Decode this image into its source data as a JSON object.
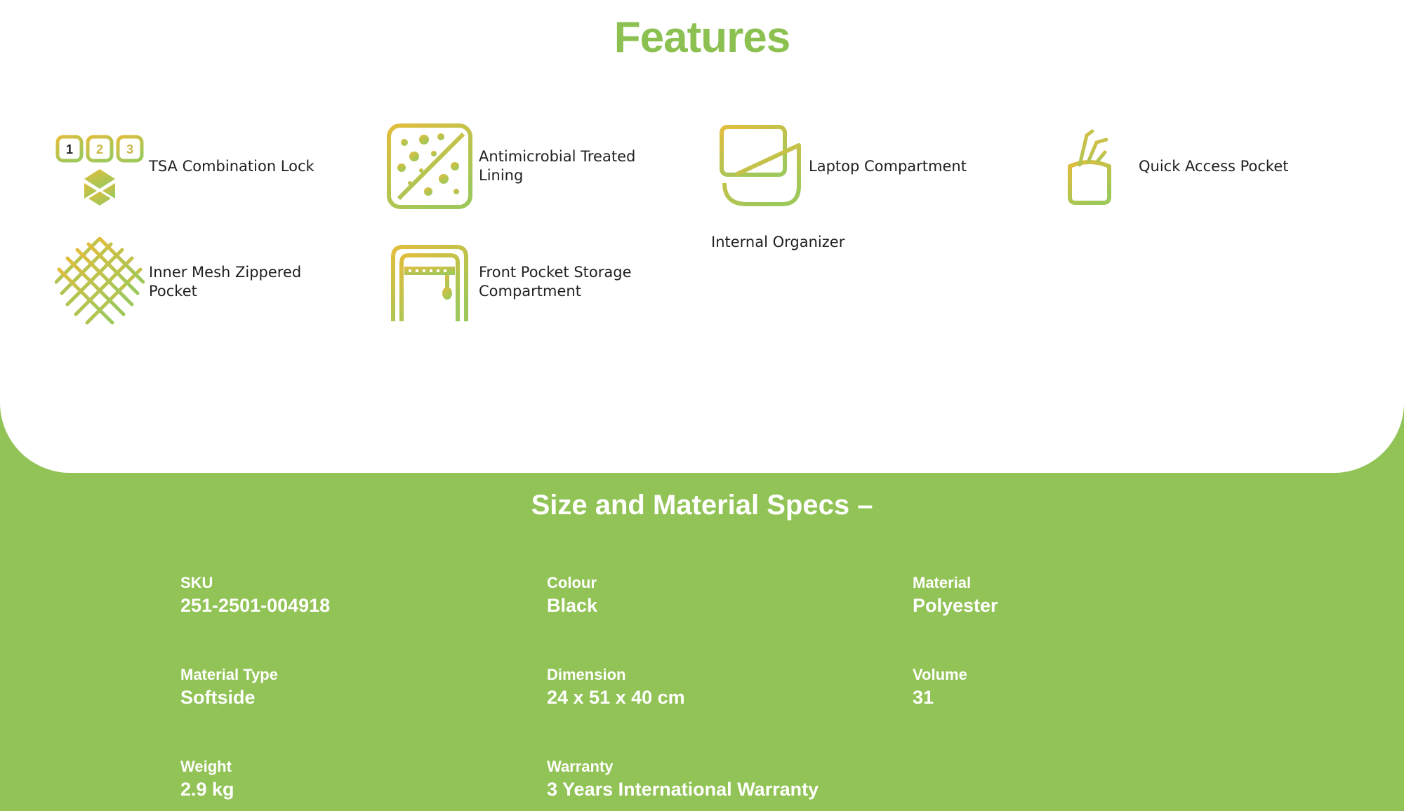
{
  "features": {
    "title": "Features",
    "items": [
      {
        "label": "TSA Combination Lock",
        "icon": "tsa-lock-icon"
      },
      {
        "label": "Antimicrobial Treated Lining",
        "icon": "antimicrobial-icon"
      },
      {
        "label": "Laptop Compartment",
        "icon": "laptop-icon"
      },
      {
        "label": "Quick Access Pocket",
        "icon": "quick-access-pocket-icon"
      },
      {
        "label": "Inner Mesh Zippered Pocket",
        "icon": "mesh-icon"
      },
      {
        "label": "Front Pocket Storage Compartment",
        "icon": "front-pocket-icon"
      }
    ],
    "internal_organizer": "Internal Organizer",
    "lock_digits": [
      "1",
      "2",
      "3"
    ]
  },
  "specs": {
    "title": "Size and Material Specs –",
    "items": [
      {
        "key": "SKU",
        "value": "251-2501-004918"
      },
      {
        "key": "Colour",
        "value": "Black"
      },
      {
        "key": "Material",
        "value": "Polyester"
      },
      {
        "key": "Material Type",
        "value": "Softside"
      },
      {
        "key": "Dimension",
        "value": "24 x 51 x 40 cm"
      },
      {
        "key": "Volume",
        "value": "31"
      },
      {
        "key": "Weight",
        "value": "2.9 kg"
      },
      {
        "key": "Warranty",
        "value": "3 Years International Warranty"
      }
    ]
  },
  "colors": {
    "accent_green": "#8cc152",
    "background_green": "#92c356",
    "icon_gradient_start": "#e2bd3c",
    "icon_gradient_end": "#9ec85a"
  }
}
